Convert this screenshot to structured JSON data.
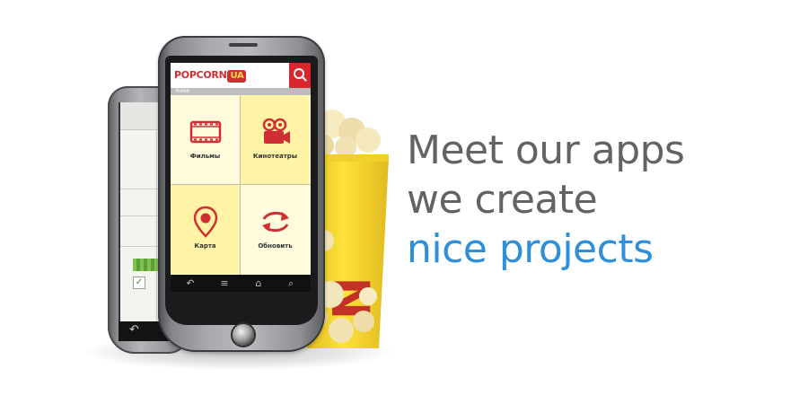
{
  "headline": {
    "line1": "Meet our apps",
    "line2": "we create",
    "line3": "nice projects"
  },
  "colors": {
    "headline_text": "#636363",
    "accent": "#2f8fd8",
    "app_red": "#cf2e33",
    "tile_light": "#fffbdc",
    "tile_yellow": "#fff3a6"
  },
  "app": {
    "logo_text": "POPCORN",
    "logo_badge": "UA",
    "city": "Киев",
    "tiles": [
      {
        "label": "Фильмы",
        "icon": "film-strip-icon"
      },
      {
        "label": "Кинотеатры",
        "icon": "movie-camera-icon"
      },
      {
        "label": "Карта",
        "icon": "map-pin-icon"
      },
      {
        "label": "Обновить",
        "icon": "refresh-arrows-icon"
      }
    ],
    "nav_icons": [
      "back-icon",
      "menu-icon",
      "home-icon",
      "search-icon"
    ]
  }
}
